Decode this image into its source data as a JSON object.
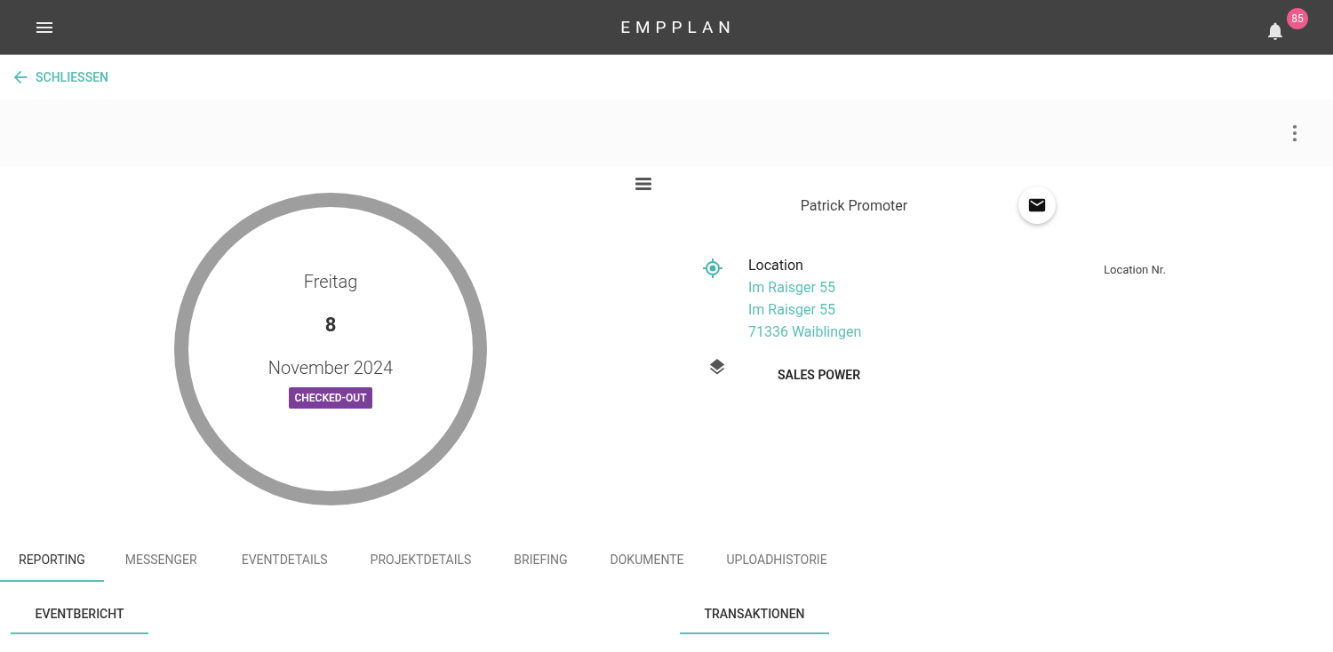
{
  "app_bar": {
    "title": "EMPPLAN",
    "notification_count": "85"
  },
  "close_link": "SCHLIESSEN",
  "date_circle": {
    "weekday": "Freitag",
    "day": "8",
    "month_year": "November 2024",
    "status": "CHECKED-OUT"
  },
  "person": {
    "name": "Patrick Promoter"
  },
  "location": {
    "label": "Location",
    "lines": [
      "Im Raisger 55",
      "Im Raisger 55",
      "71336 Waiblingen"
    ],
    "number_label": "Location Nr."
  },
  "project": {
    "name": "SALES POWER"
  },
  "tabs": [
    {
      "label": "REPORTING",
      "selected": true
    },
    {
      "label": "MESSENGER",
      "selected": false
    },
    {
      "label": "EVENTDETAILS",
      "selected": false
    },
    {
      "label": "PROJEKTDETAILS",
      "selected": false
    },
    {
      "label": "BRIEFING",
      "selected": false
    },
    {
      "label": "DOKUMENTE",
      "selected": false
    },
    {
      "label": "UPLOADHISTORIE",
      "selected": false
    }
  ],
  "sub_sections": [
    {
      "label": "EVENTBERICHT",
      "selected": true
    },
    {
      "label": "TRANSAKTIONEN",
      "selected": true
    }
  ]
}
